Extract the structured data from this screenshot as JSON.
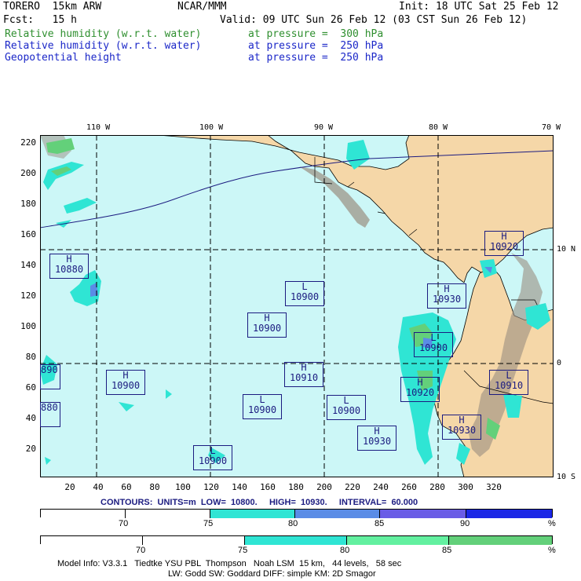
{
  "header": {
    "model": "TORERO  15km ARW",
    "center": "NCAR/MMM",
    "init": "Init: 18 UTC Sat 25 Feb 12",
    "fcst_label": "Fcst:   15 h",
    "valid": "Valid: 09 UTC Sun 26 Feb 12 (03 CST Sun 26 Feb 12)",
    "fields": [
      {
        "name": "Relative humidity (w.r.t. water)",
        "level": "at pressure =  300 hPa",
        "color": "#2f8f2f"
      },
      {
        "name": "Relative humidity (w.r.t. water)",
        "level": "at pressure =  250 hPa",
        "color": "#1b27c8"
      },
      {
        "name": "Geopotential height",
        "level": "at pressure =  250 hPa",
        "color": "#1b27c8"
      }
    ]
  },
  "map": {
    "lon_labels": [
      "110 W",
      "100 W",
      "90 W",
      "80 W",
      "70 W"
    ],
    "lat_labels": [
      "10 N",
      "0",
      "10 S"
    ],
    "y_ticks": [
      "220",
      "200",
      "180",
      "160",
      "140",
      "120",
      "100",
      "80",
      "60",
      "40",
      "20"
    ],
    "x_ticks": [
      "20",
      "40",
      "60",
      "80",
      "100",
      "120",
      "140",
      "160",
      "180",
      "200",
      "220",
      "240",
      "260",
      "280",
      "300",
      "320"
    ],
    "colors": {
      "ocean": "#ccf7f7",
      "land": "#f5d7a8",
      "mountain": "#9a8e80",
      "rh_cyan": "#2fe5d4",
      "rh_blue": "#5a8ce6",
      "rh_green": "#63d07a",
      "gridline": "#000000",
      "contour": "#1b1b80"
    },
    "centers": [
      {
        "type": "H",
        "value": "10880"
      },
      {
        "type": "L",
        "value": "10900"
      },
      {
        "type": "H",
        "value": "10900"
      },
      {
        "type": "H",
        "value": "10910"
      },
      {
        "type": "H",
        "value": "10900"
      },
      {
        "type": "",
        "value": "890"
      },
      {
        "type": "",
        "value": "880"
      },
      {
        "type": "L",
        "value": "10900"
      },
      {
        "type": "L",
        "value": "10900"
      },
      {
        "type": "L",
        "value": "10900"
      },
      {
        "type": "H",
        "value": "10930"
      },
      {
        "type": "H",
        "value": "10920"
      },
      {
        "type": "L",
        "value": "10900"
      },
      {
        "type": "H",
        "value": "10930"
      },
      {
        "type": "H",
        "value": "10920"
      },
      {
        "type": "H",
        "value": "10930"
      },
      {
        "type": "L",
        "value": "10910"
      }
    ]
  },
  "contour_info": "CONTOURS:  UNITS=m  LOW=  10800.     HIGH=  10930.     INTERVAL=  60.000",
  "colorbar1": {
    "ticks": [
      "70",
      "75",
      "80",
      "85",
      "90"
    ],
    "unit": "%",
    "colors": [
      "#ffffff",
      "#ffffff",
      "#2fe5d4",
      "#5a8ce6",
      "#6a5ce6",
      "#1b27e6"
    ]
  },
  "colorbar2": {
    "ticks": [
      "70",
      "75",
      "80",
      "85"
    ],
    "unit": "%",
    "colors": [
      "#ffffff",
      "#ffffff",
      "#2fe5d4",
      "#63f0a0",
      "#63d07a"
    ]
  },
  "footer": {
    "line1": "Model Info: V3.3.1   Tiedtke YSU PBL  Thompson   Noah LSM  15 km,   44 levels,   58 sec",
    "line2": "LW: Godd SW: Goddard DIFF: simple KM: 2D Smagor"
  }
}
